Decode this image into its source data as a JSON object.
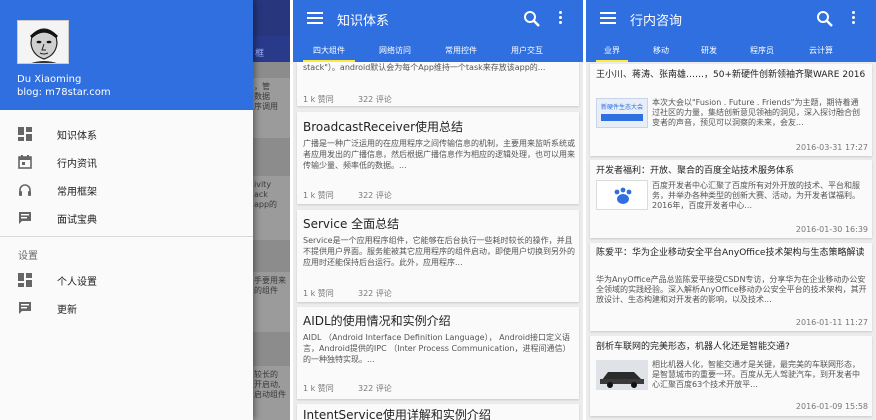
{
  "drawer": {
    "user_name": "Du Xiaoming",
    "user_blog": "blog: m78star.com",
    "items": [
      {
        "label": "知识体系",
        "icon": "dashboard-icon"
      },
      {
        "label": "行内资讯",
        "icon": "calendar-icon"
      },
      {
        "label": "常用框架",
        "icon": "headset-icon"
      },
      {
        "label": "面试宝典",
        "icon": "chat-icon"
      }
    ],
    "section_label": "设置",
    "settings_items": [
      {
        "label": "个人设置",
        "icon": "dashboard-icon"
      },
      {
        "label": "更新",
        "icon": "chat-icon"
      }
    ],
    "bg_tab": "框",
    "bg_snippets": [
      "，管\n数据\n序调用",
      "ivity\nack\napp的",
      "手要用来\n的组件",
      "较长的\n开启动,\n启动组件"
    ]
  },
  "knowledge": {
    "title": "知识体系",
    "tabs": [
      "四大组件",
      "网络访问",
      "常用控件",
      "用户交互"
    ],
    "top_snippet": "stack\"）。android默认会为每个App维持一个task来存放该app的...",
    "top_likes": "1 k 赞同",
    "top_comments": "322 评论",
    "articles": [
      {
        "title": "BroadcastReceiver使用总结",
        "body": "广播是一种广泛运用的在应用程序之间传输信息的机制，主要用来监听系统或者应用发出的广播信息，然后根据广播信息作为相应的逻辑处理，也可以用来传输少量、频率低的数据。...",
        "likes": "1 k 赞同",
        "comments": "322 评论"
      },
      {
        "title": "Service 全面总结",
        "body": "Service是一个应用程序组件，它能够在后台执行一些耗时较长的操作，并且不提供用户界面。服务能被其它应用程序的组件启动，即使用户切换到另外的应用时还能保持后台运行。此外，应用程序...",
        "likes": "1 k 赞同",
        "comments": "322 评论"
      },
      {
        "title": "AIDL的使用情况和实例介绍",
        "body": "AIDL （Android Interface Definition Language）， Android接口定义语言，Android提供的IPC （Inter Process Communication，进程间通信）的一种独特实现。...",
        "likes": "1 k 赞同",
        "comments": "322 评论"
      }
    ],
    "bottom_partial": "IntentService使用详解和实例介绍"
  },
  "news": {
    "title": "行内咨询",
    "tabs": [
      "业界",
      "移动",
      "研发",
      "程序员",
      "云计算"
    ],
    "items": [
      {
        "title": "王小川、蒋涛、张南雄……，50+新硬件创新领袖齐聚WARE 2016",
        "summary": "本次大会以\"Fusion . Future . Friends\"为主题，期待着通过社区的力量，集结创新意见领袖的洞见，深入探讨融合创变者的声音，预见可以洞察的未来，会友...",
        "date": "2016-03-31 17:27",
        "thumb": "conference-banner",
        "thumb_text": "新硬件生态大会"
      },
      {
        "title": "开发者福利：开放、聚合的百度全站技术服务体系",
        "summary": "百度开发者中心汇聚了百度所有对外开放的技术、平台和服务，并举办各种类型的创新大赛、活动，为开发者谋福利。2016年，百度开发者中心...",
        "date": "2016-01-30 16:39",
        "thumb": "baidu-dev-logo"
      },
      {
        "title": "陈爱平：华为企业移动安全平台AnyOffice技术架构与生态策略解读",
        "summary": "华为AnyOffice产品总监陈爱平接受CSDN专访，分享华为在企业移动办公安全领域的实践经验。深入解析AnyOffice移动办公安全平台的技术架构，其开放设计、生态构建和对开发者的影响，以及技术...",
        "date": "2016-01-11 11:27",
        "thumb": ""
      },
      {
        "title": "剖析车联网的完美形态，机器人化还是智能交通?",
        "summary": "相比机器人化，智能交通才是关键，最完美的车联网形态，是智慧城市的重要一环。百度从无人驾驶汽车，到开发者中心汇聚百度63个技术开放平...",
        "date": "2016-01-09 15:58",
        "thumb": "car-photo"
      }
    ]
  },
  "colors": {
    "primary": "#2f6fe0",
    "indicator": "#ffeb3b"
  }
}
